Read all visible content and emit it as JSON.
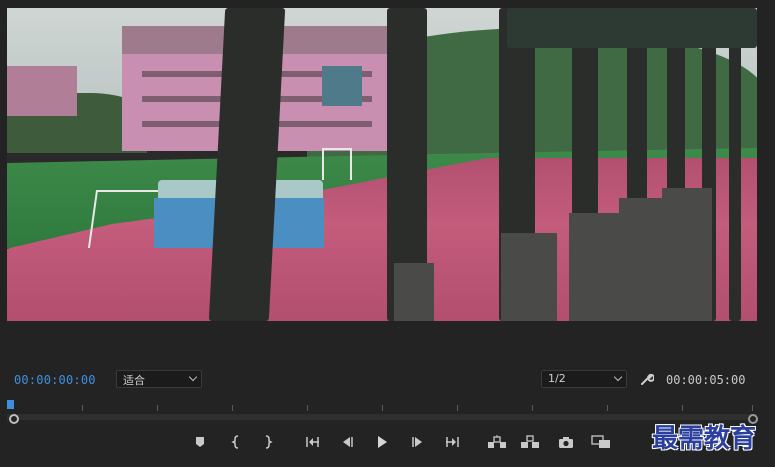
{
  "timecode": {
    "current": "00:00:00:00",
    "duration": "00:00:05:00"
  },
  "fit_select": {
    "value": "适合"
  },
  "resolution_select": {
    "value": "1/2"
  },
  "icons": {
    "wrench": "wrench-icon",
    "add_marker": "add-marker-icon",
    "mark_in": "mark-in-icon",
    "mark_out": "mark-out-icon",
    "go_to_in": "go-to-in-icon",
    "step_back": "step-back-icon",
    "play": "play-icon",
    "step_forward": "step-forward-icon",
    "go_to_out": "go-to-out-icon",
    "lift": "lift-icon",
    "extract": "extract-icon",
    "export_frame": "camera-icon",
    "compare": "comparison-view-icon"
  },
  "colors": {
    "timecode_blue": "#3f8fe0",
    "panel_bg": "#232323"
  },
  "watermark": "最需教育"
}
